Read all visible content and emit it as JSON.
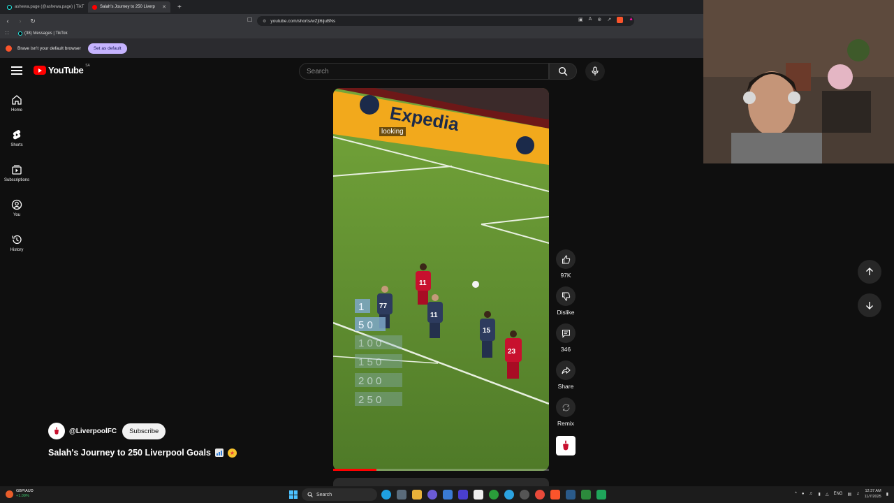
{
  "browser": {
    "tabs": [
      {
        "label": "ashewa.page (@ashewa.page) | TikT",
        "active": false
      },
      {
        "label": "Salah's Journey to 250 Liverp",
        "active": true
      }
    ],
    "url": "youtube.com/shorts/wZjt6ijuBNs",
    "bookmarks": [
      {
        "label": "(38) Messages | TikTok"
      }
    ],
    "infobar": {
      "message": "Brave isn't your default browser",
      "button": "Set as default"
    }
  },
  "youtube": {
    "logo_text": "YouTube",
    "country_code": "SA",
    "search_placeholder": "Search",
    "sidebar": [
      {
        "label": "Home",
        "icon": "home-icon"
      },
      {
        "label": "Shorts",
        "icon": "shorts-icon"
      },
      {
        "label": "Subscriptions",
        "icon": "subscriptions-icon"
      },
      {
        "label": "You",
        "icon": "you-icon"
      },
      {
        "label": "History",
        "icon": "history-icon"
      }
    ],
    "short": {
      "caption": "looking",
      "progress_fraction": 0.2,
      "channel": "@LiverpoolFC",
      "subscribe_label": "Subscribe",
      "title": "Salah's Journey to 250 Liverpool Goals",
      "title_emojis": [
        "chart-emoji",
        "star-struck-emoji"
      ],
      "overlay_numbers": [
        "1",
        "5 0",
        "1 0 0",
        "1 5 0",
        "2 0 0",
        "2 5 0"
      ],
      "ad_board_text": "Expedia",
      "player_numbers": [
        "11",
        "77",
        "11",
        "15",
        "23"
      ]
    },
    "actions": {
      "like_count": "97K",
      "dislike_label": "Dislike",
      "comment_count": "346",
      "share_label": "Share",
      "remix_label": "Remix"
    }
  },
  "taskbar": {
    "ticker": {
      "symbol": "GBP/AUD",
      "change": "+1.09%"
    },
    "search_label": "Search",
    "language": "ENG",
    "time": "12:37 AM",
    "date": "11/7/2025"
  }
}
